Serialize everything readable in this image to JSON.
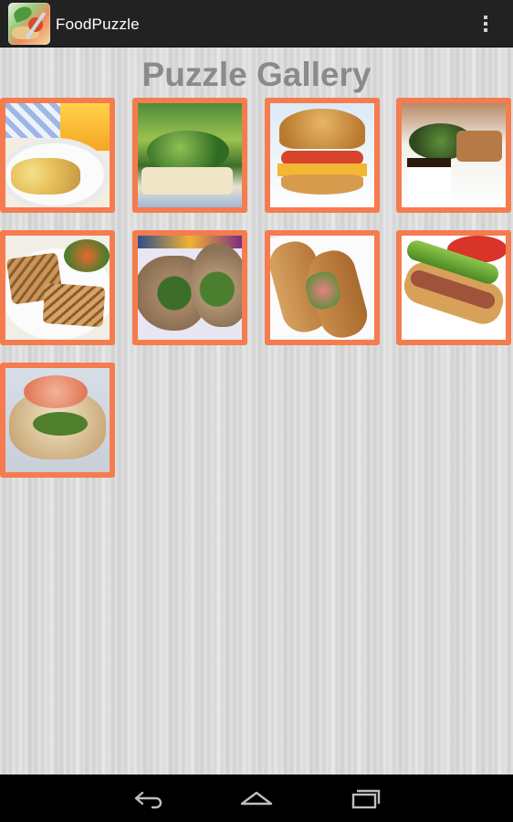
{
  "app": {
    "title": "FoodPuzzle",
    "icon": "food-puzzle-app-icon"
  },
  "actionbar": {
    "overflow_icon": "overflow-menu-icon"
  },
  "gallery": {
    "title": "Puzzle Gallery",
    "items": [
      {
        "id": 1,
        "subject": "fruit-salad-plate"
      },
      {
        "id": 2,
        "subject": "green-salad-sandwich"
      },
      {
        "id": 3,
        "subject": "bagel-sandwich"
      },
      {
        "id": 4,
        "subject": "salad-and-coffee"
      },
      {
        "id": 5,
        "subject": "panini-plate"
      },
      {
        "id": 6,
        "subject": "wraps"
      },
      {
        "id": 7,
        "subject": "baguette-sandwich"
      },
      {
        "id": 8,
        "subject": "chicago-hot-dog"
      },
      {
        "id": 9,
        "subject": "shrimp-sandwich"
      }
    ],
    "tile_color": "#f47c4f"
  },
  "navbar": {
    "back_icon": "back-icon",
    "home_icon": "home-icon",
    "recents_icon": "recents-icon"
  }
}
